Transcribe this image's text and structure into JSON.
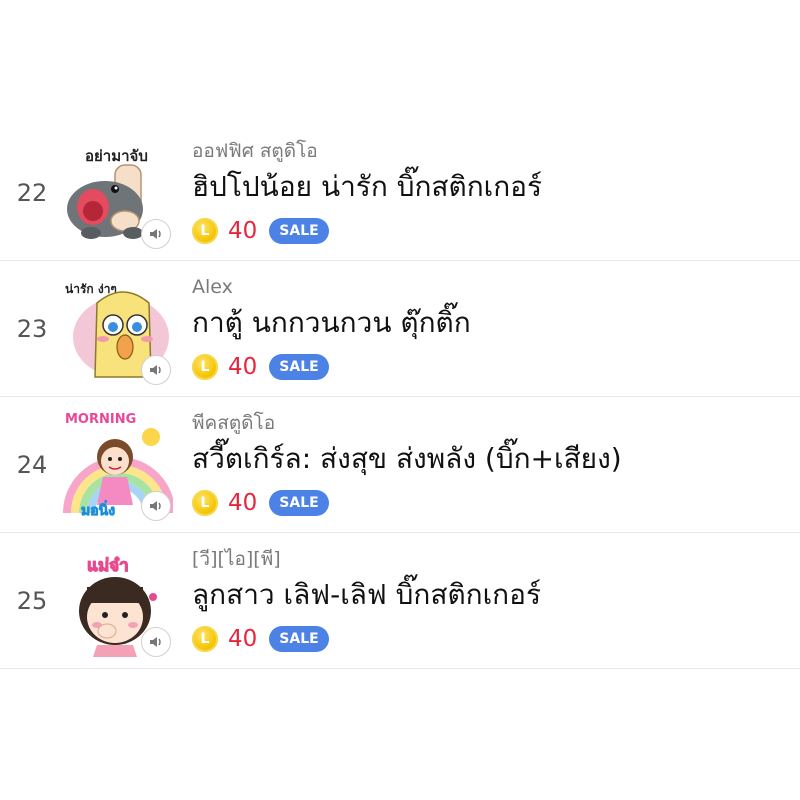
{
  "items": [
    {
      "rank": "22",
      "author": "ออฟฟิศ สตูดิโอ",
      "title": "ฮิปโปน้อย น่ารัก บิ๊กสติกเกอร์",
      "price": "40",
      "coin_symbol": "L",
      "badge": "SALE",
      "thumb_caption": "อย่ามาจับ",
      "thumb_icon": "hippo-sticker-icon"
    },
    {
      "rank": "23",
      "author": "Alex",
      "title": "กาตู้ นกกวนกวน ตุ๊กติ๊ก",
      "price": "40",
      "coin_symbol": "L",
      "badge": "SALE",
      "thumb_caption": "น่ารัก ง่าๆ",
      "thumb_icon": "bird-sticker-icon"
    },
    {
      "rank": "24",
      "author": "พีคสตูดิโอ",
      "title": "สวี๊ตเกิร์ล: ส่งสุข ส่งพลัง (บิ๊ก+เสียง)",
      "price": "40",
      "coin_symbol": "L",
      "badge": "SALE",
      "thumb_caption": "MORNING",
      "thumb_caption2": "มอนิ่ง",
      "thumb_icon": "girl-rainbow-sticker-icon"
    },
    {
      "rank": "25",
      "author": "[วี][ไอ][พี]",
      "title": "ลูกสาว เลิฟ-เลิฟ บิ๊กสติกเกอร์",
      "price": "40",
      "coin_symbol": "L",
      "badge": "SALE",
      "thumb_caption": "แม่จ๋า",
      "thumb_icon": "girl-sticker-icon"
    }
  ],
  "colors": {
    "price": "#e8253f",
    "sale_badge": "#4c82e6",
    "coin": "#f5c400"
  }
}
